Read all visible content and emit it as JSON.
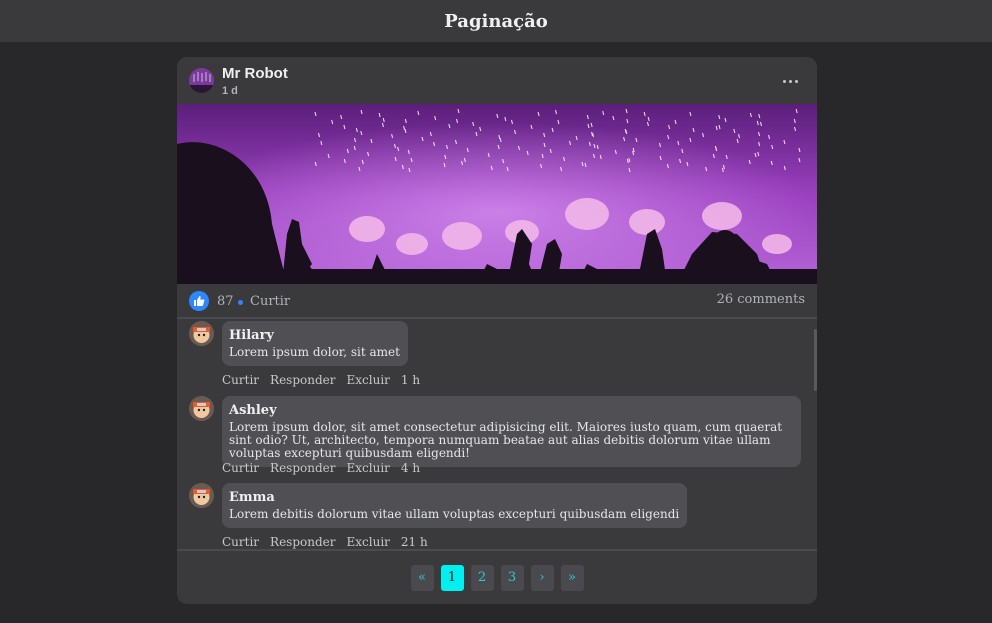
{
  "header": {
    "title": "Paginação"
  },
  "post": {
    "author": "Mr Robot",
    "time": "1 d",
    "likes": "87",
    "like_label": "Curtir",
    "comments_count": "26 comments"
  },
  "comments": [
    {
      "name": "Hilary",
      "text": "Lorem ipsum dolor, sit amet",
      "actions": [
        "Curtir",
        "Responder",
        "Excluir"
      ],
      "time": "1 h"
    },
    {
      "name": "Ashley",
      "text": "Lorem ipsum dolor, sit amet consectetur adipisicing elit. Maiores iusto quam, cum quaerat sint odio? Ut, architecto, tempora numquam beatae aut alias debitis dolorum vitae ullam voluptas excepturi quibusdam eligendi!",
      "actions": [
        "Curtir",
        "Responder",
        "Excluir"
      ],
      "time": "4 h"
    },
    {
      "name": "Emma",
      "text": "Lorem debitis dolorum vitae ullam voluptas excepturi quibusdam eligendi",
      "actions": [
        "Curtir",
        "Responder",
        "Excluir"
      ],
      "time": "21 h"
    }
  ],
  "pagination": {
    "first": "«",
    "prev": "‹",
    "pages": [
      "1",
      "2",
      "3"
    ],
    "next": "›",
    "last": "»",
    "active_page": "1"
  },
  "colors": {
    "background": "#28282b",
    "card": "#3a3a3d",
    "accent": "#00f0f0",
    "like_blue": "#2d88ff"
  },
  "icons": {
    "avatar_post": "concert-avatar-icon",
    "more": "more-options-icon",
    "like": "thumbs-up-icon",
    "comment_avatar": "ninja-avatar-icon"
  }
}
